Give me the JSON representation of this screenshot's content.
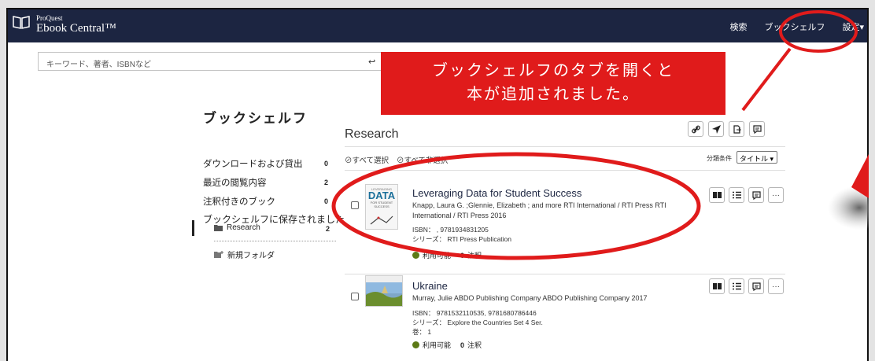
{
  "topbar": {
    "brand_small": "ProQuest",
    "brand_large": "Ebook Central™",
    "nav": [
      "検索",
      "ブックシェルフ",
      "設定▾"
    ]
  },
  "search": {
    "placeholder": "キーワード、著者、ISBNなど",
    "button_glyph": "↩"
  },
  "sidebar": {
    "title": "ブックシェルフ",
    "items": [
      {
        "label": "ダウンロードおよび貸出",
        "count": "0"
      },
      {
        "label": "最近の閲覧内容",
        "count": "2"
      },
      {
        "label": "注釈付きのブック",
        "count": "0"
      },
      {
        "label": "ブックシェルフに保存されました",
        "count": ""
      }
    ],
    "folder": {
      "label": "Research",
      "count": "2"
    },
    "new_folder": "新規フォルダ"
  },
  "main": {
    "folder_title": "Research",
    "select_all": "⊘すべて選択",
    "deselect_all": "⊘すべて非選択",
    "sort_label": "分類条件",
    "sort_value": "タイトル"
  },
  "books": [
    {
      "title": "Leveraging Data for Student Success",
      "authors_line1": "Knapp, Laura G. ;Glennie, Elizabeth ; and more  RTI International / RTI Press  RTI",
      "authors_line2": "International / RTI Press  2016",
      "isbn": "ISBN： , 9781934831205",
      "series": "シリーズ： RTI Press Publication",
      "volume": "",
      "available": "利用可能",
      "notes_count": "0",
      "notes_label": "注釈",
      "cover_text": "DATA",
      "cover_top": "LEVERAGING",
      "cover_sub": "FOR STUDENT SUCCESS"
    },
    {
      "title": "Ukraine",
      "authors_line1": "Murray, Julie  ABDO Publishing Company  ABDO Publishing Company  2017",
      "authors_line2": "",
      "isbn": "ISBN： 9781532110535, 9781680786446",
      "series": "シリーズ： Explore the Countries Set 4 Ser.",
      "volume": "巻： 1",
      "available": "利用可能",
      "notes_count": "0",
      "notes_label": "注釈",
      "cover_text": "",
      "cover_top": "",
      "cover_sub": ""
    }
  ],
  "more_glyph": "···",
  "callout": {
    "line1": "ブックシェルフのタブを開くと",
    "line2": "本が追加されました。"
  },
  "colors": {
    "topbar": "#1c2541",
    "annotation": "#e01b1b",
    "available_dot": "#5c7a16"
  }
}
